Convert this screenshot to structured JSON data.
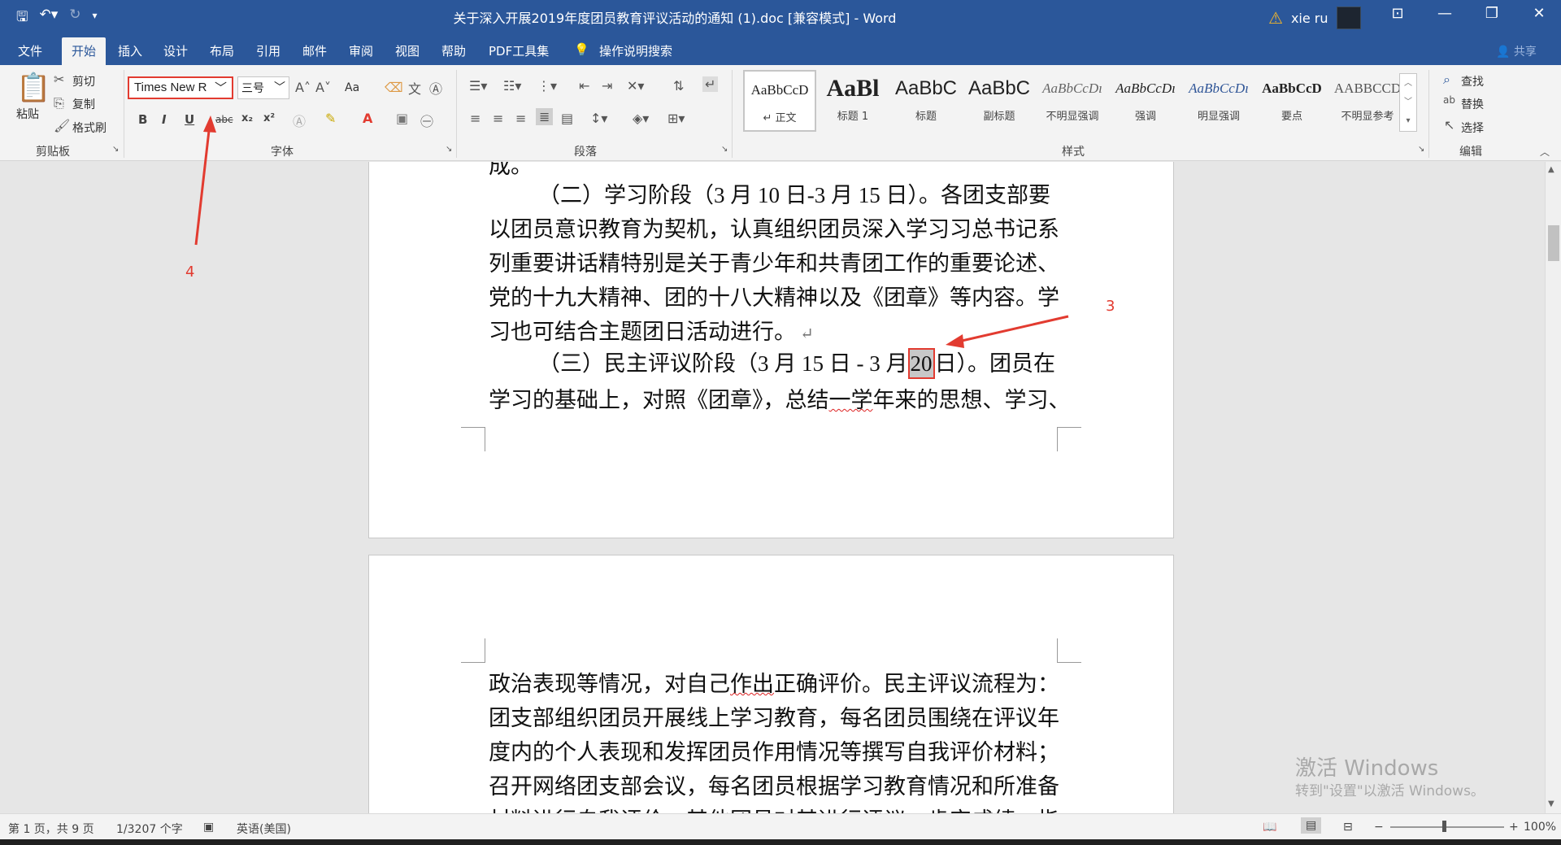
{
  "titlebar": {
    "title": "关于深入开展2019年度团员教育评议活动的通知 (1).doc [兼容模式] - Word",
    "user": "xie ru",
    "qat_icons": [
      "save-icon",
      "undo-icon",
      "redo-icon",
      "customize-icon"
    ]
  },
  "tabs": [
    "文件",
    "开始",
    "插入",
    "设计",
    "布局",
    "引用",
    "邮件",
    "审阅",
    "视图",
    "帮助",
    "PDF工具集",
    "操作说明搜索"
  ],
  "share": "共享",
  "ribbon": {
    "clipboard": {
      "paste": "粘贴",
      "cut": "剪切",
      "copy": "复制",
      "painter": "格式刷",
      "label": "剪贴板"
    },
    "font": {
      "name": "Times New R",
      "size": "三号",
      "case": "Aa",
      "label": "字体"
    },
    "paragraph": {
      "label": "段落"
    },
    "styles": {
      "label": "样式",
      "items": [
        {
          "preview": "AaBbCcD",
          "name": "↵ 正文"
        },
        {
          "preview": "AaBl",
          "name": "标题 1"
        },
        {
          "preview": "AaBbC",
          "name": "标题"
        },
        {
          "preview": "AaBbC",
          "name": "副标题"
        },
        {
          "preview": "AaBbCcDı",
          "name": "不明显强调"
        },
        {
          "preview": "AaBbCcDı",
          "name": "强调"
        },
        {
          "preview": "AaBbCcDı",
          "name": "明显强调"
        },
        {
          "preview": "AaBbCcD",
          "name": "要点"
        },
        {
          "preview": "AABBCCD",
          "name": "不明显参考"
        }
      ]
    },
    "editing": {
      "find": "查找",
      "replace": "替换",
      "select": "选择",
      "label": "编辑"
    }
  },
  "doc": {
    "top_partial": "成。",
    "p1": [
      "（二）学习阶段（3 月 10 日-3 月 15 日）。各团支部要",
      "以团员意识教育为契机，认真组织团员深入学习习总书记系",
      "列重要讲话精特别是关于青少年和共青团工作的重要论述、",
      "党的十九大精神、团的十八大精神以及《团章》等内容。学",
      "习也可结合主题团日活动进行。"
    ],
    "p2_line1_before": "（三）民主评议阶段（3 月 15 日 - 3 月",
    "p2_highlight": "20",
    "p2_line1_after": "日）。团员在",
    "p2_line2_a": "学习的基础上，对照《团章》，总结",
    "p2_line2_wavy": "一学",
    "p2_line2_b": "年来的思想、学习、",
    "page2": [
      {
        "a": "政治表现等情况，对自己",
        "w": "作出",
        "b": "正确评价。民主评议流程为："
      },
      {
        "a": "团支部组织团员开展线上学习教育，每名团员围绕在评议年",
        "w": "",
        "b": ""
      },
      {
        "a": "度内的个人表现和发挥团员作用情况等撰写自我评价材料；",
        "w": "",
        "b": ""
      },
      {
        "a": "召开网络团支部会议，每名团员根据学习教育情况和所准备",
        "w": "",
        "b": ""
      },
      {
        "a": "材料进行自我评价；其他团员对其进行评议，肯定成绩、指",
        "w": "",
        "b": ""
      }
    ]
  },
  "annotations": {
    "a3": "3",
    "a4": "4"
  },
  "watermark": {
    "line1": "激活 Windows",
    "line2": "转到\"设置\"以激活 Windows。"
  },
  "status": {
    "page": "第 1 页，共 9 页",
    "words": "1/3207 个字",
    "lang": "英语(美国)",
    "zoom": "100%"
  }
}
